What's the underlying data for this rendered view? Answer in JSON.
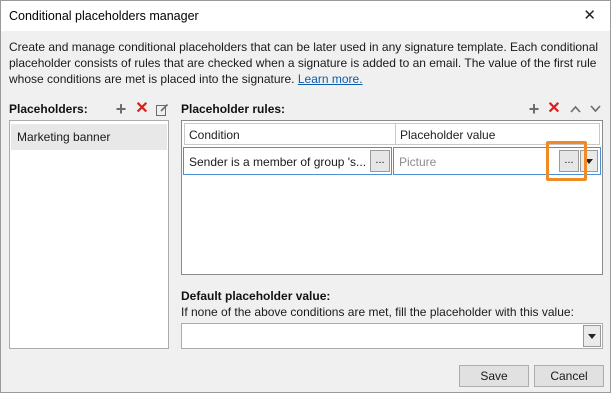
{
  "window": {
    "title": "Conditional placeholders manager",
    "close_glyph": "✕"
  },
  "description": {
    "text": "Create and manage conditional placeholders that can be later used in any signature template. Each conditional placeholder consists of rules that are checked when a signature is added to an email. The value of the first rule whose conditions are met is placed into the signature. ",
    "link": "Learn more."
  },
  "placeholders": {
    "label": "Placeholders:",
    "items": [
      "Marketing banner"
    ],
    "toolbar": {
      "add_icon": "plus-icon",
      "delete_icon": "delete-icon",
      "edit_icon": "edit-icon"
    }
  },
  "rules": {
    "label": "Placeholder rules:",
    "columns": [
      "Condition",
      "Placeholder value"
    ],
    "rows": [
      {
        "condition": "Sender is a member of group 's...",
        "value_placeholder": "Picture"
      }
    ],
    "browse_label": "...",
    "toolbar": {
      "add_icon": "plus-icon",
      "delete_icon": "delete-icon",
      "up_icon": "chevron-up-icon",
      "down_icon": "chevron-down-icon"
    }
  },
  "default_value": {
    "label": "Default placeholder value:",
    "description": "If none of the above conditions are met, fill the placeholder with this value:",
    "value": ""
  },
  "buttons": {
    "save": "Save",
    "cancel": "Cancel"
  },
  "colors": {
    "accent_highlight": "#f08a24",
    "link": "#0b5cad",
    "delete_red": "#d9201c",
    "selection_border": "#4a90d9"
  }
}
